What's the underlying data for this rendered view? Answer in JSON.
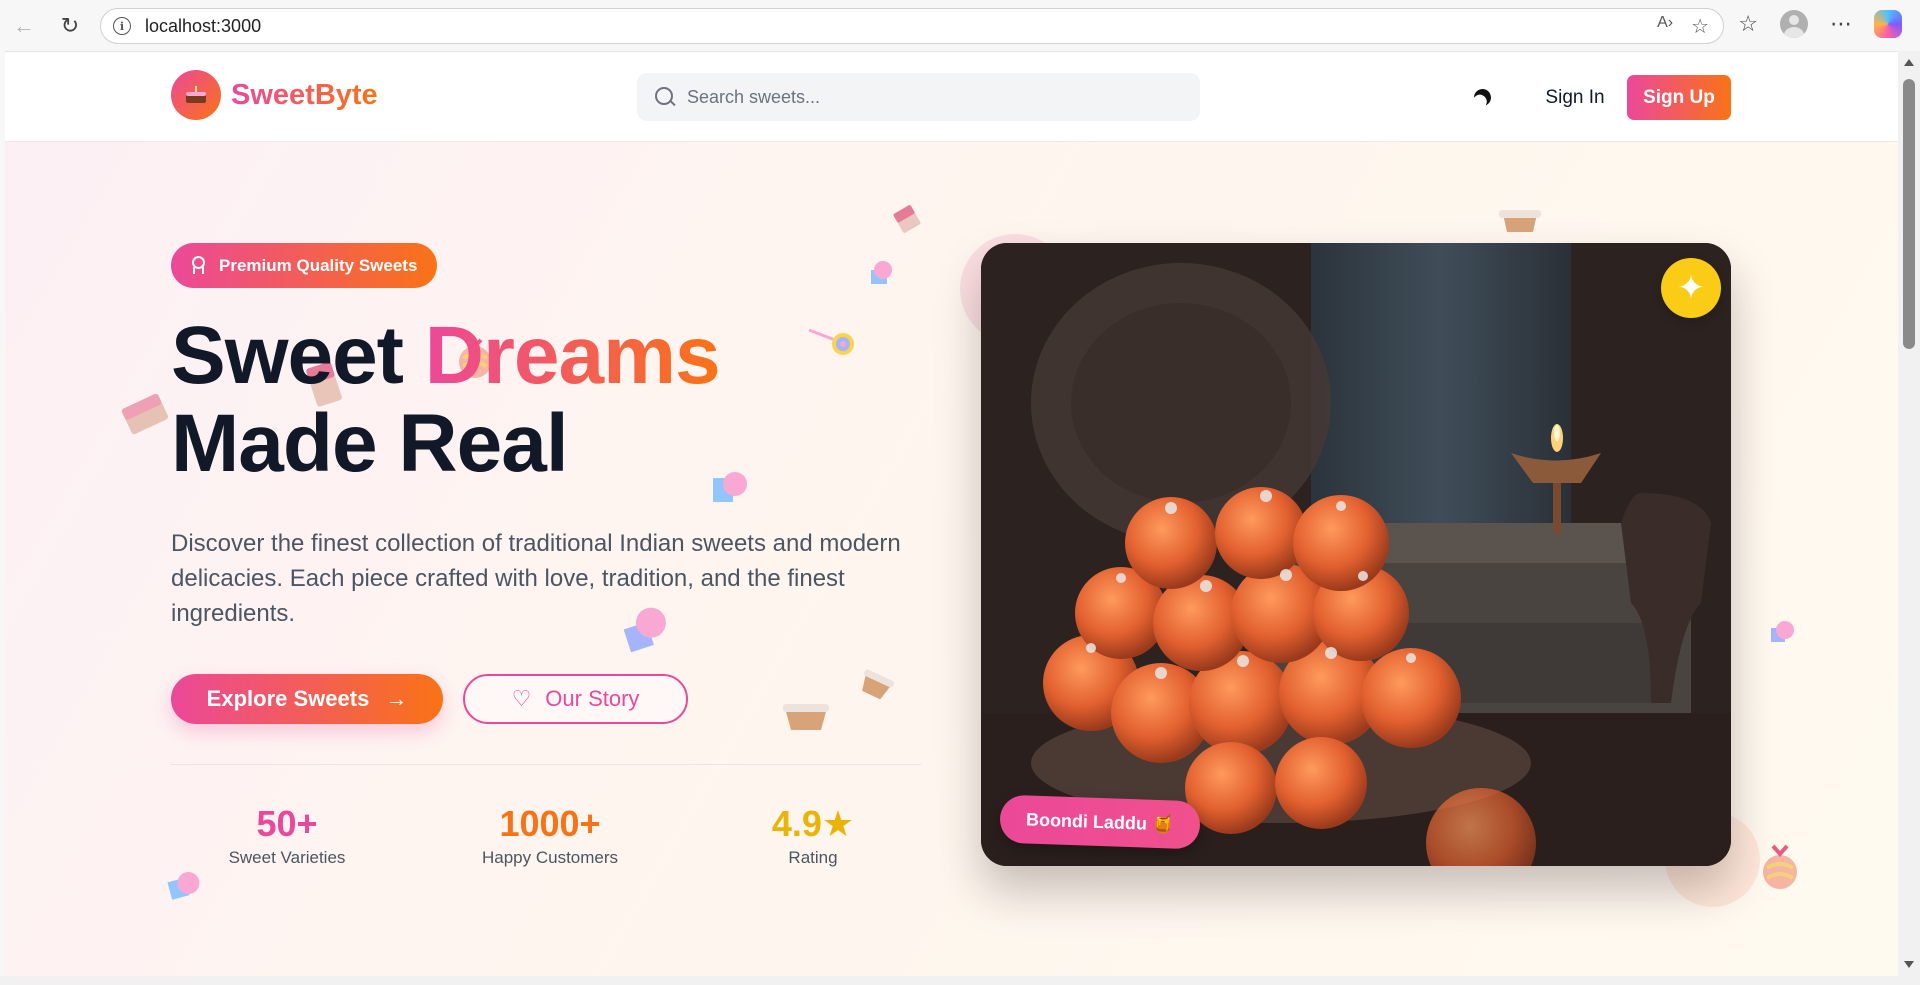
{
  "browser": {
    "url": "localhost:3000",
    "icons": [
      "back-icon",
      "reload-icon",
      "info-icon",
      "read-aloud-icon",
      "favorite-star-icon",
      "favorites-icon",
      "profile-icon",
      "more-icon",
      "copilot-icon"
    ]
  },
  "header": {
    "brand": "SweetByte",
    "logo_icon": "cake-icon",
    "search_placeholder": "Search sweets...",
    "sign_in": "Sign In",
    "sign_up": "Sign Up"
  },
  "hero": {
    "badge": "Premium Quality Sweets",
    "headline_part1": "Sweet ",
    "headline_accent": "Dreams",
    "headline_part2": "Made Real",
    "description": "Discover the finest collection of traditional Indian sweets and modern delicacies. Each piece crafted with love, tradition, and the finest ingredients.",
    "explore_button": "Explore Sweets",
    "story_button": "Our Story",
    "stats": [
      {
        "value": "50+",
        "label": "Sweet Varieties",
        "color": "#ec4899"
      },
      {
        "value": "1000+",
        "label": "Happy Customers",
        "color": "#f97316"
      },
      {
        "value": "4.9★",
        "label": "Rating",
        "color": "#eab308"
      }
    ],
    "image_tag": "Boondi Laddu 🍯"
  },
  "colors": {
    "brand_pink": "#ec4899",
    "brand_orange": "#f97316",
    "sparkle_yellow": "#facc15"
  }
}
